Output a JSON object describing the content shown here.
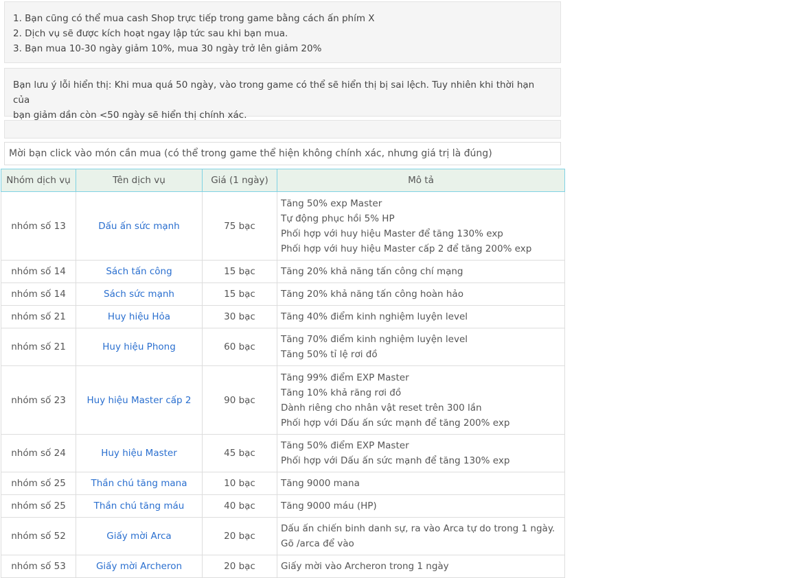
{
  "notices": {
    "tips": [
      "1. Bạn cũng có thể mua cash Shop trực tiếp trong game bằng cách ấn phím X",
      "2. Dịch vụ sẽ được kích hoạt ngay lập tức sau khi bạn mua.",
      "3. Bạn mua 10-30 ngày giảm 10%, mua 30 ngày trở lên giảm 20%"
    ],
    "warning": [
      "Bạn lưu ý lỗi hiển thị: Khi mua quá 50 ngày, vào trong game có thể sẽ hiển thị bị sai lệch. Tuy nhiên khi thời hạn của",
      "bạn giảm dần còn <50 ngày sẽ hiển thị chính xác."
    ]
  },
  "instruction": "Mời bạn click vào món cần mua (có thể trong game thể hiện không chính xác, nhưng giá trị là đúng)",
  "table": {
    "headers": [
      "Nhóm dịch vụ",
      "Tên dịch vụ",
      "Giá (1 ngày)",
      "Mô tả"
    ],
    "rows": [
      {
        "group": "nhóm số 13",
        "name": "Dấu ấn sức mạnh",
        "price": "75 bạc",
        "desc": [
          "Tăng 50% exp Master",
          "Tự động phục hồi 5% HP",
          "Phối hợp với huy hiệu Master để tăng 130% exp",
          "Phối hợp với huy hiệu Master cấp 2 để tăng 200% exp"
        ]
      },
      {
        "group": "nhóm số 14",
        "name": "Sách tấn công",
        "price": "15 bạc",
        "desc": [
          "Tăng 20% khả năng tấn công chí mạng"
        ]
      },
      {
        "group": "nhóm số 14",
        "name": "Sách sức mạnh",
        "price": "15 bạc",
        "desc": [
          "Tăng 20% khả năng tấn công hoàn hảo"
        ]
      },
      {
        "group": "nhóm số 21",
        "name": "Huy hiệu Hỏa",
        "price": "30 bạc",
        "desc": [
          "Tăng 40% điểm kinh nghiệm luyện level"
        ]
      },
      {
        "group": "nhóm số 21",
        "name": "Huy hiệu Phong",
        "price": "60 bạc",
        "desc": [
          "Tăng 70% điểm kinh nghiệm luyện level",
          "Tăng 50% tỉ lệ rơi đồ"
        ]
      },
      {
        "group": "nhóm số 23",
        "name": "Huy hiệu Master cấp 2",
        "price": "90 bạc",
        "desc": [
          "Tăng 99% điểm EXP Master",
          "Tăng 10% khả răng rơi đồ",
          "Dành riêng cho nhân vật reset trên 300 lần",
          "Phối hợp với Dấu ấn sức mạnh để tăng 200% exp"
        ]
      },
      {
        "group": "nhóm số 24",
        "name": "Huy hiệu Master",
        "price": "45 bạc",
        "desc": [
          "Tăng 50% điểm EXP Master",
          "Phối hợp với Dấu ấn sức mạnh để tăng 130% exp"
        ]
      },
      {
        "group": "nhóm số 25",
        "name": "Thần chú tăng mana",
        "price": "10 bạc",
        "desc": [
          "Tăng 9000 mana"
        ]
      },
      {
        "group": "nhóm số 25",
        "name": "Thần chú tăng máu",
        "price": "40 bạc",
        "desc": [
          "Tăng 9000 máu (HP)"
        ]
      },
      {
        "group": "nhóm số 52",
        "name": "Giấy mời Arca",
        "price": "20 bạc",
        "desc": [
          "Dấu ấn chiến binh danh sự, ra vào Arca tự do trong 1 ngày.",
          "Gõ /arca để vào"
        ]
      },
      {
        "group": "nhóm số 53",
        "name": "Giấy mời Archeron",
        "price": "20 bạc",
        "desc": [
          "Giấy mời vào Archeron trong 1 ngày"
        ]
      }
    ]
  },
  "colors": {
    "link": "#2a6fcf",
    "header_bg": "#e9f2ea",
    "header_border": "#7fd2e3",
    "notice_bg": "#f5f5f5"
  }
}
